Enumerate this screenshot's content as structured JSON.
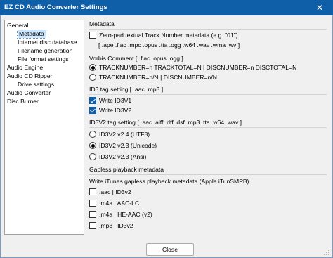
{
  "window": {
    "title": "EZ CD Audio Converter Settings",
    "close_glyph": "✕"
  },
  "tree": {
    "items": [
      {
        "label": "General"
      },
      {
        "label": "Metadata"
      },
      {
        "label": "Internet disc database"
      },
      {
        "label": "Filename generation"
      },
      {
        "label": "File format settings"
      },
      {
        "label": "Audio Engine"
      },
      {
        "label": "Audio CD Ripper"
      },
      {
        "label": "Drive settings"
      },
      {
        "label": "Audio Converter"
      },
      {
        "label": "Disc Burner"
      }
    ],
    "selected": "Metadata"
  },
  "metadata": {
    "title": "Metadata",
    "zero_pad_label": "Zero-pad textual Track Number metadata (e.g. \"01\")",
    "zero_pad_checked": false,
    "formats_note": "[ .ape .flac .mpc .opus .tta .ogg .w64 .wav .wma .wv ]",
    "vorbis_title": "Vorbis Comment [ .flac .opus .ogg ]",
    "vorbis_opt1": "TRACKNUMBER=n TRACKTOTAL=N | DISCNUMBER=n DISCTOTAL=N",
    "vorbis_opt2": "TRACKNUMBER=n/N | DISCNUMBER=n/N",
    "vorbis_selected": 1
  },
  "id3": {
    "title": "ID3 tag setting [ .aac .mp3 ]",
    "v1_label": "Write ID3V1",
    "v1_checked": true,
    "v2_label": "Write ID3V2",
    "v2_checked": true
  },
  "id3v2": {
    "title": "ID3V2 tag setting [ .aac .aiff .dff .dsf .mp3 .tta .w64 .wav ]",
    "options": [
      "ID3V2 v2.4 (UTF8)",
      "ID3V2 v2.3 (Unicode)",
      "ID3V2 v2.3 (Ansi)"
    ],
    "selected": 1
  },
  "gapless": {
    "title": "Gapless playback metadata",
    "subtitle": "Write iTunes gapless playback metadata (Apple iTunSMPB)",
    "options": [
      ".aac | ID3v2",
      ".m4a | AAC-LC",
      ".m4a | HE-AAC (v2)",
      ".mp3 | ID3v2"
    ]
  },
  "footer": {
    "close_label": "Close"
  },
  "colors": {
    "titlebar": "#0f5fa8",
    "accent": "#0f5fa8",
    "selection": "#cce8ff"
  }
}
